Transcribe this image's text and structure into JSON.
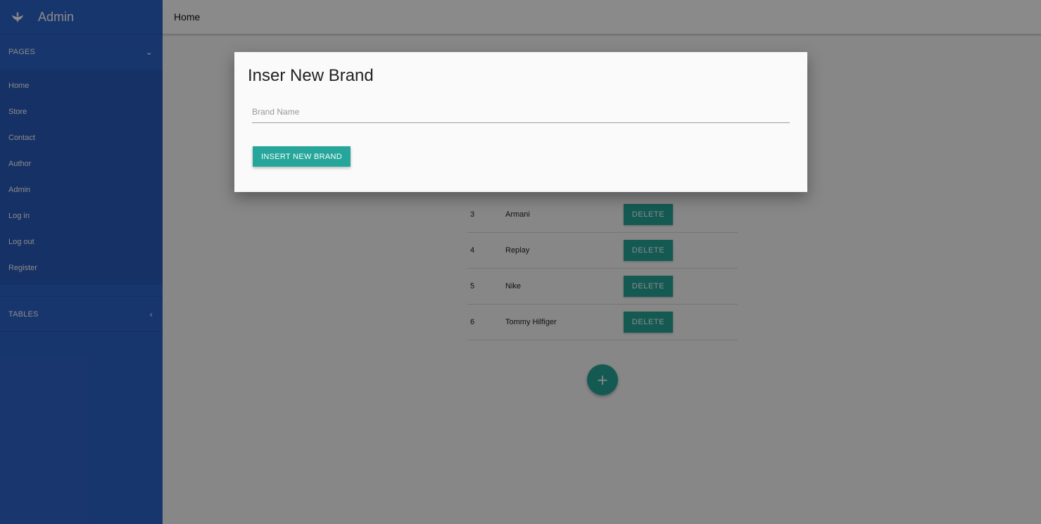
{
  "sidebar": {
    "brand_title": "Admin",
    "brand_icon": "leaf-icon",
    "pages_header": "PAGES",
    "pages_items": [
      "Home",
      "Store",
      "Contact",
      "Author",
      "Admin",
      "Log in",
      "Log out",
      "Register"
    ],
    "tables_header": "TABLES"
  },
  "topbar": {
    "title": "Home"
  },
  "brands": {
    "rows": [
      {
        "id": "3",
        "name": "Armani"
      },
      {
        "id": "4",
        "name": "Replay"
      },
      {
        "id": "5",
        "name": "Nike"
      },
      {
        "id": "6",
        "name": "Tommy Hilfiger"
      }
    ],
    "delete_label": "DELETE",
    "fab_label": "+"
  },
  "modal": {
    "title": "Inser New Brand",
    "input_placeholder": "Brand Name",
    "input_value": "",
    "submit_label": "INSERT NEW BRAND"
  },
  "colors": {
    "sidebar": "#2e65cc",
    "accent": "#26a69a"
  }
}
